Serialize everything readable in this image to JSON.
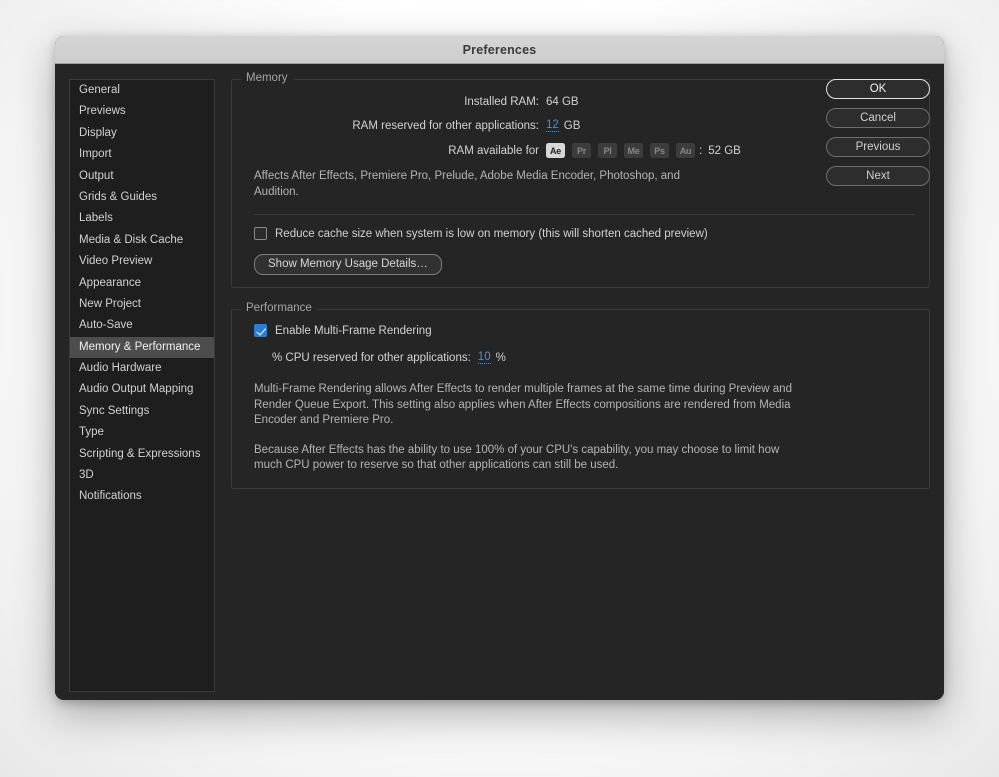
{
  "window": {
    "title": "Preferences"
  },
  "sidebar": {
    "items": [
      {
        "label": "General",
        "selected": false
      },
      {
        "label": "Previews",
        "selected": false
      },
      {
        "label": "Display",
        "selected": false
      },
      {
        "label": "Import",
        "selected": false
      },
      {
        "label": "Output",
        "selected": false
      },
      {
        "label": "Grids & Guides",
        "selected": false
      },
      {
        "label": "Labels",
        "selected": false
      },
      {
        "label": "Media & Disk Cache",
        "selected": false
      },
      {
        "label": "Video Preview",
        "selected": false
      },
      {
        "label": "Appearance",
        "selected": false
      },
      {
        "label": "New Project",
        "selected": false
      },
      {
        "label": "Auto-Save",
        "selected": false
      },
      {
        "label": "Memory & Performance",
        "selected": true
      },
      {
        "label": "Audio Hardware",
        "selected": false
      },
      {
        "label": "Audio Output Mapping",
        "selected": false
      },
      {
        "label": "Sync Settings",
        "selected": false
      },
      {
        "label": "Type",
        "selected": false
      },
      {
        "label": "Scripting & Expressions",
        "selected": false
      },
      {
        "label": "3D",
        "selected": false
      },
      {
        "label": "Notifications",
        "selected": false
      }
    ]
  },
  "memory": {
    "group_label": "Memory",
    "installed_ram_label": "Installed RAM:",
    "installed_ram_value": "64 GB",
    "reserved_label": "RAM reserved for other applications:",
    "reserved_value": "12",
    "reserved_unit": "GB",
    "available_label": "RAM available for",
    "available_colon": ":",
    "available_value": "52 GB",
    "apps": [
      {
        "code": "Ae",
        "name": "after-effects",
        "active": true
      },
      {
        "code": "Pr",
        "name": "premiere-pro",
        "active": false
      },
      {
        "code": "Pl",
        "name": "prelude",
        "active": false
      },
      {
        "code": "Me",
        "name": "media-encoder",
        "active": false
      },
      {
        "code": "Ps",
        "name": "photoshop",
        "active": false
      },
      {
        "code": "Au",
        "name": "audition",
        "active": false
      }
    ],
    "affects_note": "Affects After Effects, Premiere Pro, Prelude, Adobe Media Encoder, Photoshop, and Audition.",
    "reduce_cache_label": "Reduce cache size when system is low on memory (this will shorten cached preview)",
    "reduce_cache_checked": false,
    "show_details_button": "Show Memory Usage Details…"
  },
  "performance": {
    "group_label": "Performance",
    "mfr_label": "Enable Multi-Frame Rendering",
    "mfr_checked": true,
    "cpu_label": "% CPU reserved for other applications:",
    "cpu_value": "10",
    "cpu_unit": "%",
    "paragraph_1": "Multi-Frame Rendering allows After Effects to render multiple frames at the same time during Preview and Render Queue Export. This setting also applies when After Effects compositions are rendered from Media Encoder and Premiere Pro.",
    "paragraph_2": "Because After Effects has the ability to use 100% of your CPU's capability, you may choose to limit how much CPU power to reserve so that other applications can still be used."
  },
  "buttons": {
    "ok": "OK",
    "cancel": "Cancel",
    "previous": "Previous",
    "next": "Next"
  },
  "colors": {
    "accent_blue": "#4b8fd4",
    "checkbox_blue": "#2a7fd4",
    "window_bg": "#252525",
    "sidebar_bg": "#1e1e1e",
    "selection": "#4d4d4d"
  }
}
